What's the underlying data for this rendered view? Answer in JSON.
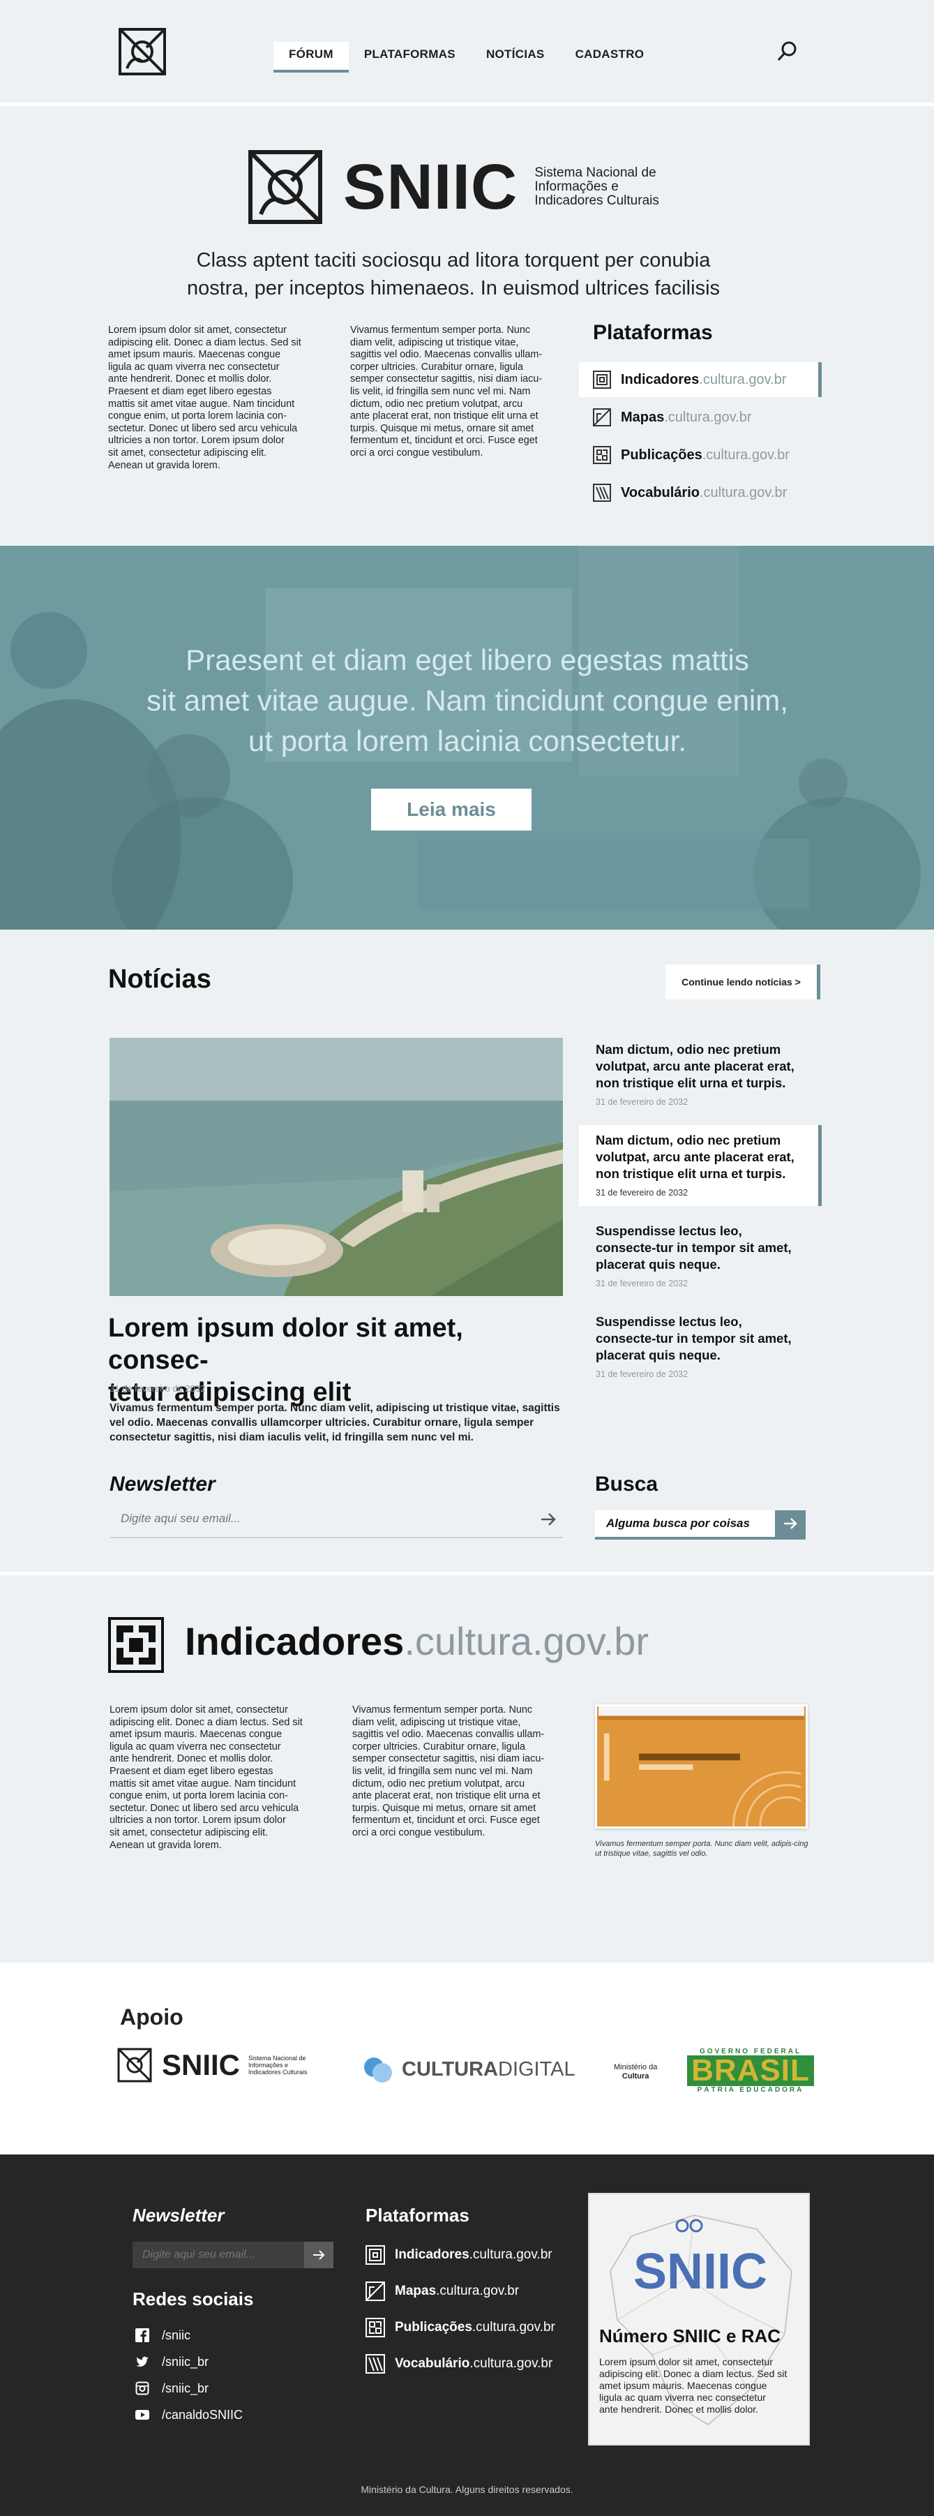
{
  "nav": {
    "items": [
      {
        "label": "FÓRUM",
        "active": true
      },
      {
        "label": "PLATAFORMAS",
        "active": false
      },
      {
        "label": "NOTÍCIAS",
        "active": false
      },
      {
        "label": "CADASTRO",
        "active": false
      }
    ]
  },
  "brand": {
    "name": "SNIIC",
    "sub_line1": "Sistema Nacional de",
    "sub_line2": "Informações e",
    "sub_line3": "Indicadores Culturais"
  },
  "intro": {
    "tagline_line1": "Class aptent taciti sociosqu ad litora torquent per conubia",
    "tagline_line2": "nostra, per inceptos himenaeos. In euismod ultrices facilisis",
    "col1": [
      "Lorem ipsum dolor sit amet, consectetur",
      "adipiscing elit. Donec a diam lectus. Sed sit",
      "amet ipsum mauris. Maecenas congue",
      "ligula ac quam viverra nec consectetur",
      "ante hendrerit. Donec et mollis dolor.",
      "Praesent et diam eget libero egestas",
      "mattis sit amet vitae augue. Nam tincidunt",
      "congue enim, ut porta lorem lacinia con-",
      "sectetur. Donec ut libero sed arcu vehicula",
      "ultricies a non tortor. Lorem ipsum dolor",
      "sit amet, consectetur adipiscing elit.",
      "Aenean ut gravida lorem."
    ],
    "col2": [
      "Vivamus fermentum semper porta. Nunc",
      "diam velit, adipiscing ut tristique vitae,",
      "sagittis vel odio. Maecenas convallis ullam-",
      "corper ultricies. Curabitur ornare, ligula",
      "semper consectetur sagittis, nisi diam iacu-",
      "lis velit, id fringilla sem nunc vel mi. Nam",
      "dictum, odio nec pretium volutpat, arcu",
      "ante placerat erat, non tristique elit urna et",
      "turpis. Quisque mi metus, ornare sit amet",
      "fermentum et, tincidunt et orci. Fusce eget",
      "orci a orci congue vestibulum."
    ]
  },
  "plataformas": {
    "title": "Plataformas",
    "items": [
      {
        "name": "Indicadores",
        "domain": ".cultura.gov.br",
        "icon": "indicadores-icon",
        "active": true
      },
      {
        "name": "Mapas",
        "domain": ".cultura.gov.br",
        "icon": "mapas-icon",
        "active": false
      },
      {
        "name": "Publicações",
        "domain": ".cultura.gov.br",
        "icon": "publicacoes-icon",
        "active": false
      },
      {
        "name": "Vocabulário",
        "domain": ".cultura.gov.br",
        "icon": "vocabulario-icon",
        "active": false
      }
    ]
  },
  "hero": {
    "line1": "Praesent et diam eget libero egestas mattis",
    "line2": "sit amet vitae augue. Nam tincidunt congue enim,",
    "line3": "ut porta lorem lacinia consectetur.",
    "button": "Leia mais"
  },
  "news": {
    "title": "Notícias",
    "more": "Continue lendo notícias >",
    "lead_title_line1": "Lorem ipsum dolor sit amet, consec-",
    "lead_title_line2": "tetur adipiscing elit",
    "lead_date": "31 de fevereiro de 2032",
    "lead_desc": "Vivamus fermentum semper porta. Nunc diam velit, adipiscing ut tristique vitae, sagittis vel odio. Maecenas convallis ullamcorper ultricies. Curabitur ornare, ligula semper consectetur sagittis, nisi diam iaculis velit, id fringilla sem nunc vel mi.",
    "items": [
      {
        "title": "Nam dictum, odio nec pretium volutpat, arcu ante placerat erat, non tristique elit urna et turpis.",
        "date": "31 de fevereiro de 2032",
        "active": false
      },
      {
        "title": "Nam dictum, odio nec pretium volutpat, arcu ante placerat erat, non tristique elit urna et turpis.",
        "date": "31 de fevereiro de 2032",
        "active": true
      },
      {
        "title": "Suspendisse lectus leo, consecte-tur in tempor sit amet, placerat quis neque.",
        "date": "31 de fevereiro de 2032",
        "active": false
      },
      {
        "title": "Suspendisse lectus leo, consecte-tur in tempor sit amet, placerat quis neque.",
        "date": "31 de fevereiro de 2032",
        "active": false
      }
    ],
    "newsletter_label": "Newsletter",
    "newsletter_placeholder": "Digite aqui seu email...",
    "busca_label": "Busca",
    "busca_value": "Alguma busca por coisas"
  },
  "indicadores": {
    "name": "Indicadores",
    "domain": ".cultura.gov.br",
    "col1": [
      "Lorem ipsum dolor sit amet, consectetur",
      "adipiscing elit. Donec a diam lectus. Sed sit",
      "amet ipsum mauris. Maecenas congue",
      "ligula ac quam viverra nec consectetur",
      "ante hendrerit. Donec et mollis dolor.",
      "Praesent et diam eget libero egestas",
      "mattis sit amet vitae augue. Nam tincidunt",
      "congue enim, ut porta lorem lacinia con-",
      "sectetur. Donec ut libero sed arcu vehicula",
      "ultricies a non tortor. Lorem ipsum dolor",
      "sit amet, consectetur adipiscing elit.",
      "Aenean ut gravida lorem."
    ],
    "col2": [
      "Vivamus fermentum semper porta. Nunc",
      "diam velit, adipiscing ut tristique vitae,",
      "sagittis vel odio. Maecenas convallis ullam-",
      "corper ultricies. Curabitur ornare, ligula",
      "semper consectetur sagittis, nisi diam iacu-",
      "lis velit, id fringilla sem nunc vel mi. Nam",
      "dictum, odio nec pretium volutpat, arcu",
      "ante placerat erat, non tristique elit urna et",
      "turpis. Quisque mi metus, ornare sit amet",
      "fermentum et, tincidunt et orci. Fusce eget",
      "orci a orci congue vestibulum."
    ],
    "caption": "Vivamus fermentum semper porta. Nunc diam velit, adipis-cing ut tristique vitae, sagittis vel odio."
  },
  "apoio": {
    "title": "Apoio",
    "sniic": "SNIIC",
    "sniic_sub1": "Sistema Nacional de",
    "sniic_sub2": "Informações e",
    "sniic_sub3": "Indicadores Culturais",
    "cultura_bold": "CULTURA",
    "cultura_light": " DIGITAL",
    "ministerio1": "Ministério da",
    "ministerio2": "Cultura",
    "gov_top": "GOVERNO FEDERAL",
    "gov_mid": "BRASIL",
    "gov_bottom": "PÁTRIA EDUCADORA"
  },
  "footer": {
    "newsletter": "Newsletter",
    "newsletter_placeholder": "Digite aqui seu email...",
    "redes": "Redes sociais",
    "social": [
      {
        "label": "/sniic",
        "icon": "facebook-icon"
      },
      {
        "label": "/sniic_br",
        "icon": "twitter-icon"
      },
      {
        "label": "/sniic_br",
        "icon": "instagram-icon"
      },
      {
        "label": "/canaldoSNIIC",
        "icon": "youtube-icon"
      }
    ],
    "plataformas": "Plataformas",
    "plat_items": [
      {
        "name": "Indicadores",
        "domain": ".cultura.gov.br"
      },
      {
        "name": "Mapas",
        "domain": ".cultura.gov.br"
      },
      {
        "name": "Publicações",
        "domain": ".cultura.gov.br"
      },
      {
        "name": "Vocabulário",
        "domain": ".cultura.gov.br"
      }
    ],
    "card_logo": "SNIIC",
    "card_title": "Número SNIIC e RAC",
    "card_text": [
      "Lorem ipsum dolor sit amet, consectetur",
      "adipiscing elit. Donec a diam lectus. Sed sit",
      "amet ipsum mauris. Maecenas congue",
      "ligula ac quam viverra nec consectetur",
      "ante hendrerit. Donec et mollis dolor."
    ],
    "copyright": "Ministério da Cultura. Alguns direitos reservados."
  },
  "colors": {
    "accent": "#6c8d96",
    "hero": "#6e9aa0",
    "footer": "#262626",
    "muted": "#8c9aa0"
  }
}
